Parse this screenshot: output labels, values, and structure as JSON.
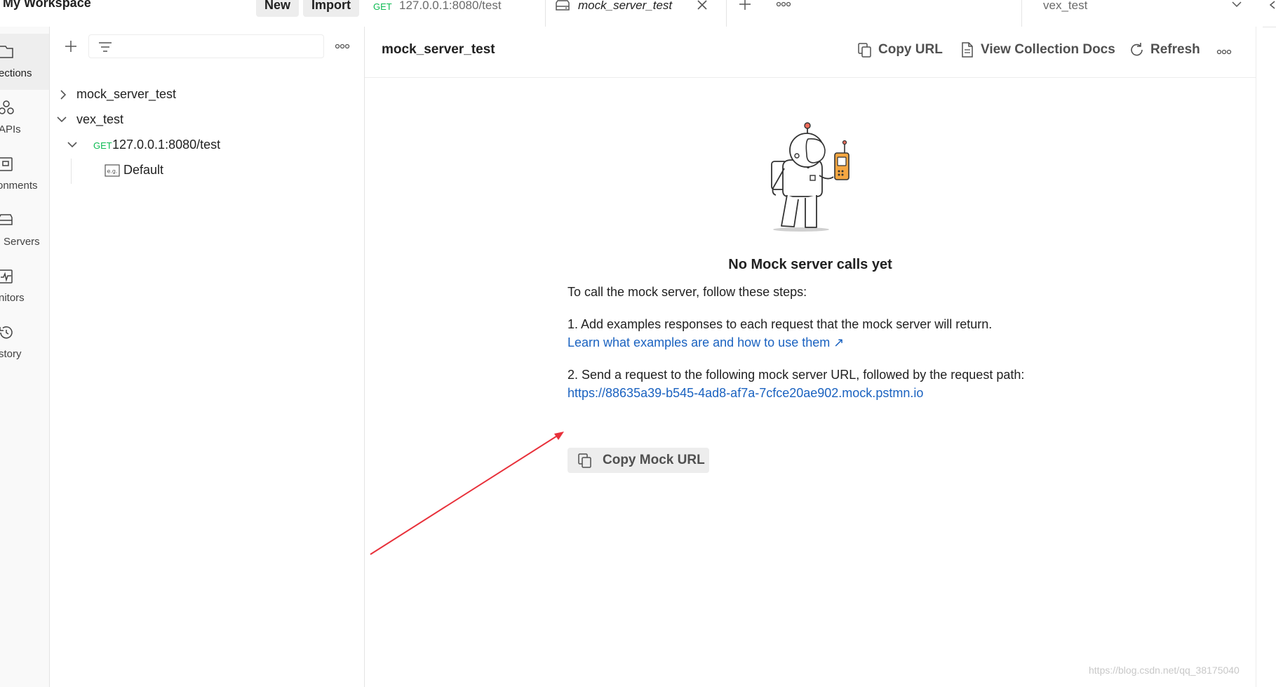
{
  "header": {
    "workspace_title": "My Workspace",
    "new_label": "New",
    "import_label": "Import"
  },
  "tabs": [
    {
      "method": "GET",
      "label": "127.0.0.1:8080/test"
    },
    {
      "label": "mock_server_test",
      "icon": "mock-server-icon"
    }
  ],
  "environment": {
    "label": "vex_test"
  },
  "rail": [
    {
      "label": "ections",
      "icon": "collections-icon"
    },
    {
      "label": "APIs",
      "icon": "apis-icon"
    },
    {
      "label": "onments",
      "icon": "environments-icon"
    },
    {
      "label": "Servers",
      "icon": "mock-servers-icon"
    },
    {
      "label": "nitors",
      "icon": "monitors-icon"
    },
    {
      "label": "story",
      "icon": "history-icon"
    }
  ],
  "sidebar": {
    "tree": [
      {
        "label": "mock_server_test"
      },
      {
        "label": "vex_test"
      },
      {
        "method": "GET",
        "label": "127.0.0.1:8080/test"
      },
      {
        "label": "Default",
        "icon": "example-icon"
      }
    ]
  },
  "main": {
    "title": "mock_server_test",
    "copy_url_label": "Copy URL",
    "view_docs_label": "View Collection Docs",
    "refresh_label": "Refresh",
    "empty_title": "No Mock server calls yet",
    "intro": "To call the mock server, follow these steps:",
    "step1": "1. Add examples responses to each request that the mock server will return.",
    "step1_link": "Learn what examples are and how to use them ↗",
    "step2": "2. Send a request to the following mock server URL, followed by the request path:",
    "mock_url": "https://88635a39-b545-4ad8-af7a-7cfce20ae902.mock.pstmn.io",
    "copy_mock_label": "Copy Mock URL"
  },
  "annotation": {
    "color": "#e8303a"
  },
  "watermark": "https://blog.csdn.net/qq_38175040",
  "colors": {
    "get_method": "#0cbb52",
    "link": "#1a62c0",
    "button_bg": "#ededed",
    "border": "#e4e4e4"
  }
}
